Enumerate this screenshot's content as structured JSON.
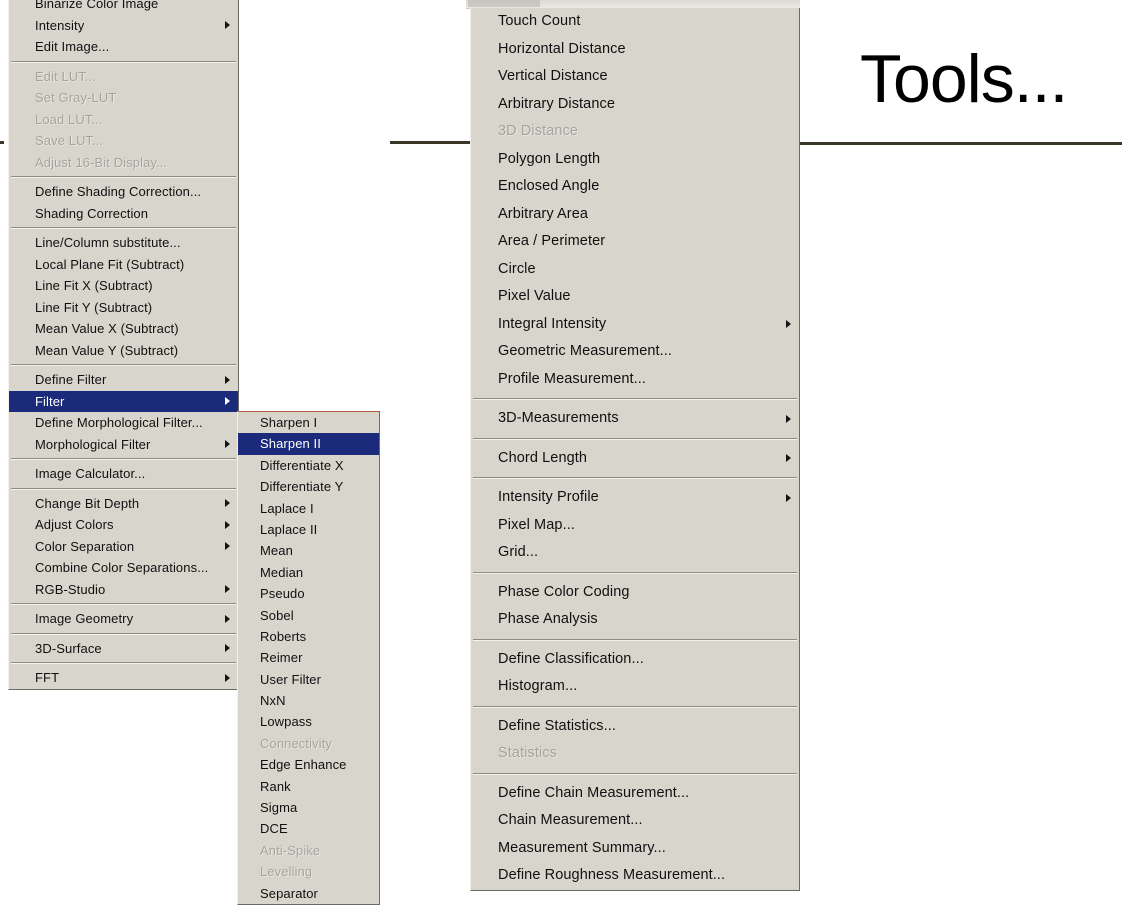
{
  "slide": {
    "title": "Tools..."
  },
  "menubar_strip": {
    "visible": true
  },
  "left_menu": {
    "name": "process-menu",
    "groups": [
      {
        "items": [
          {
            "label": "Binarize Color Image",
            "submenu": false,
            "disabled": false,
            "selected": false
          },
          {
            "label": "Intensity",
            "submenu": true,
            "disabled": false,
            "selected": false
          },
          {
            "label": "Edit Image...",
            "submenu": false,
            "disabled": false,
            "selected": false
          }
        ]
      },
      {
        "items": [
          {
            "label": "Edit LUT...",
            "submenu": false,
            "disabled": true,
            "selected": false
          },
          {
            "label": "Set Gray-LUT",
            "submenu": false,
            "disabled": true,
            "selected": false
          },
          {
            "label": "Load LUT...",
            "submenu": false,
            "disabled": true,
            "selected": false
          },
          {
            "label": "Save LUT...",
            "submenu": false,
            "disabled": true,
            "selected": false
          },
          {
            "label": "Adjust 16-Bit Display...",
            "submenu": false,
            "disabled": true,
            "selected": false
          }
        ]
      },
      {
        "items": [
          {
            "label": "Define Shading Correction...",
            "submenu": false,
            "disabled": false,
            "selected": false
          },
          {
            "label": "Shading Correction",
            "submenu": false,
            "disabled": false,
            "selected": false
          }
        ]
      },
      {
        "items": [
          {
            "label": "Line/Column substitute...",
            "submenu": false,
            "disabled": false,
            "selected": false
          },
          {
            "label": "Local Plane Fit (Subtract)",
            "submenu": false,
            "disabled": false,
            "selected": false
          },
          {
            "label": "Line Fit X (Subtract)",
            "submenu": false,
            "disabled": false,
            "selected": false
          },
          {
            "label": "Line Fit Y (Subtract)",
            "submenu": false,
            "disabled": false,
            "selected": false
          },
          {
            "label": "Mean Value X (Subtract)",
            "submenu": false,
            "disabled": false,
            "selected": false
          },
          {
            "label": "Mean Value Y (Subtract)",
            "submenu": false,
            "disabled": false,
            "selected": false
          }
        ]
      },
      {
        "items": [
          {
            "label": "Define Filter",
            "submenu": true,
            "disabled": false,
            "selected": false
          },
          {
            "label": "Filter",
            "submenu": true,
            "disabled": false,
            "selected": true
          },
          {
            "label": "Define Morphological Filter...",
            "submenu": false,
            "disabled": false,
            "selected": false
          },
          {
            "label": "Morphological Filter",
            "submenu": true,
            "disabled": false,
            "selected": false
          }
        ]
      },
      {
        "items": [
          {
            "label": "Image Calculator...",
            "submenu": false,
            "disabled": false,
            "selected": false
          }
        ]
      },
      {
        "items": [
          {
            "label": "Change Bit Depth",
            "submenu": true,
            "disabled": false,
            "selected": false
          },
          {
            "label": "Adjust Colors",
            "submenu": true,
            "disabled": false,
            "selected": false
          },
          {
            "label": "Color Separation",
            "submenu": true,
            "disabled": false,
            "selected": false
          },
          {
            "label": "Combine Color Separations...",
            "submenu": false,
            "disabled": false,
            "selected": false
          },
          {
            "label": "RGB-Studio",
            "submenu": true,
            "disabled": false,
            "selected": false
          }
        ]
      },
      {
        "items": [
          {
            "label": "Image Geometry",
            "submenu": true,
            "disabled": false,
            "selected": false
          }
        ]
      },
      {
        "items": [
          {
            "label": "3D-Surface",
            "submenu": true,
            "disabled": false,
            "selected": false
          }
        ]
      },
      {
        "items": [
          {
            "label": "FFT",
            "submenu": true,
            "disabled": false,
            "selected": false
          }
        ]
      }
    ]
  },
  "filter_submenu": {
    "name": "filter-submenu",
    "groups": [
      {
        "items": [
          {
            "label": "Sharpen I",
            "submenu": false,
            "disabled": false,
            "selected": false
          },
          {
            "label": "Sharpen II",
            "submenu": false,
            "disabled": false,
            "selected": true
          },
          {
            "label": "Differentiate X",
            "submenu": false,
            "disabled": false,
            "selected": false
          },
          {
            "label": "Differentiate Y",
            "submenu": false,
            "disabled": false,
            "selected": false
          },
          {
            "label": "Laplace I",
            "submenu": false,
            "disabled": false,
            "selected": false
          },
          {
            "label": "Laplace II",
            "submenu": false,
            "disabled": false,
            "selected": false
          },
          {
            "label": "Mean",
            "submenu": false,
            "disabled": false,
            "selected": false
          },
          {
            "label": "Median",
            "submenu": false,
            "disabled": false,
            "selected": false
          },
          {
            "label": "Pseudo",
            "submenu": false,
            "disabled": false,
            "selected": false
          },
          {
            "label": "Sobel",
            "submenu": false,
            "disabled": false,
            "selected": false
          },
          {
            "label": "Roberts",
            "submenu": false,
            "disabled": false,
            "selected": false
          },
          {
            "label": "Reimer",
            "submenu": false,
            "disabled": false,
            "selected": false
          },
          {
            "label": "User Filter",
            "submenu": false,
            "disabled": false,
            "selected": false
          },
          {
            "label": "NxN",
            "submenu": false,
            "disabled": false,
            "selected": false
          },
          {
            "label": "Lowpass",
            "submenu": false,
            "disabled": false,
            "selected": false
          },
          {
            "label": "Connectivity",
            "submenu": false,
            "disabled": true,
            "selected": false
          },
          {
            "label": "Edge Enhance",
            "submenu": false,
            "disabled": false,
            "selected": false
          },
          {
            "label": "Rank",
            "submenu": false,
            "disabled": false,
            "selected": false
          },
          {
            "label": "Sigma",
            "submenu": false,
            "disabled": false,
            "selected": false
          },
          {
            "label": "DCE",
            "submenu": false,
            "disabled": false,
            "selected": false
          },
          {
            "label": "Anti-Spike",
            "submenu": false,
            "disabled": true,
            "selected": false
          },
          {
            "label": "Levelling",
            "submenu": false,
            "disabled": true,
            "selected": false
          },
          {
            "label": "Separator",
            "submenu": false,
            "disabled": false,
            "selected": false
          }
        ]
      }
    ]
  },
  "right_menu": {
    "name": "measure-menu",
    "groups": [
      {
        "items": [
          {
            "label": "Touch Count",
            "submenu": false,
            "disabled": false,
            "selected": false
          },
          {
            "label": "Horizontal Distance",
            "submenu": false,
            "disabled": false,
            "selected": false
          },
          {
            "label": "Vertical Distance",
            "submenu": false,
            "disabled": false,
            "selected": false
          },
          {
            "label": "Arbitrary Distance",
            "submenu": false,
            "disabled": false,
            "selected": false
          },
          {
            "label": "3D Distance",
            "submenu": false,
            "disabled": true,
            "selected": false
          },
          {
            "label": "Polygon Length",
            "submenu": false,
            "disabled": false,
            "selected": false
          },
          {
            "label": "Enclosed Angle",
            "submenu": false,
            "disabled": false,
            "selected": false
          },
          {
            "label": "Arbitrary Area",
            "submenu": false,
            "disabled": false,
            "selected": false
          },
          {
            "label": "Area / Perimeter",
            "submenu": false,
            "disabled": false,
            "selected": false
          },
          {
            "label": "Circle",
            "submenu": false,
            "disabled": false,
            "selected": false
          },
          {
            "label": "Pixel Value",
            "submenu": false,
            "disabled": false,
            "selected": false
          },
          {
            "label": "Integral Intensity",
            "submenu": true,
            "disabled": false,
            "selected": false
          },
          {
            "label": "Geometric Measurement...",
            "submenu": false,
            "disabled": false,
            "selected": false
          },
          {
            "label": "Profile Measurement...",
            "submenu": false,
            "disabled": false,
            "selected": false
          }
        ]
      },
      {
        "items": [
          {
            "label": "3D-Measurements",
            "submenu": true,
            "disabled": false,
            "selected": false
          }
        ]
      },
      {
        "items": [
          {
            "label": "Chord Length",
            "submenu": true,
            "disabled": false,
            "selected": false
          }
        ]
      },
      {
        "items": [
          {
            "label": "Intensity Profile",
            "submenu": true,
            "disabled": false,
            "selected": false
          },
          {
            "label": "Pixel Map...",
            "submenu": false,
            "disabled": false,
            "selected": false
          },
          {
            "label": "Grid...",
            "submenu": false,
            "disabled": false,
            "selected": false
          }
        ]
      },
      {
        "items": [
          {
            "label": "Phase Color Coding",
            "submenu": false,
            "disabled": false,
            "selected": false
          },
          {
            "label": "Phase Analysis",
            "submenu": false,
            "disabled": false,
            "selected": false
          }
        ]
      },
      {
        "items": [
          {
            "label": "Define Classification...",
            "submenu": false,
            "disabled": false,
            "selected": false
          },
          {
            "label": "Histogram...",
            "submenu": false,
            "disabled": false,
            "selected": false
          }
        ]
      },
      {
        "items": [
          {
            "label": "Define Statistics...",
            "submenu": false,
            "disabled": false,
            "selected": false
          },
          {
            "label": "Statistics",
            "submenu": false,
            "disabled": true,
            "selected": false
          }
        ]
      },
      {
        "items": [
          {
            "label": "Define Chain Measurement...",
            "submenu": false,
            "disabled": false,
            "selected": false
          },
          {
            "label": "Chain Measurement...",
            "submenu": false,
            "disabled": false,
            "selected": false
          },
          {
            "label": "Measurement Summary...",
            "submenu": false,
            "disabled": false,
            "selected": false
          },
          {
            "label": "Define Roughness Measurement...",
            "submenu": false,
            "disabled": false,
            "selected": false
          }
        ]
      }
    ]
  },
  "colors": {
    "menu_background": "#d8d5cd",
    "selection": "#1b2a7a",
    "selection_text": "#ffffff",
    "disabled_text": "#a4a29b",
    "text": "#101010",
    "rule": "#3a3628",
    "submenu_top_accent": "#b4573a"
  }
}
